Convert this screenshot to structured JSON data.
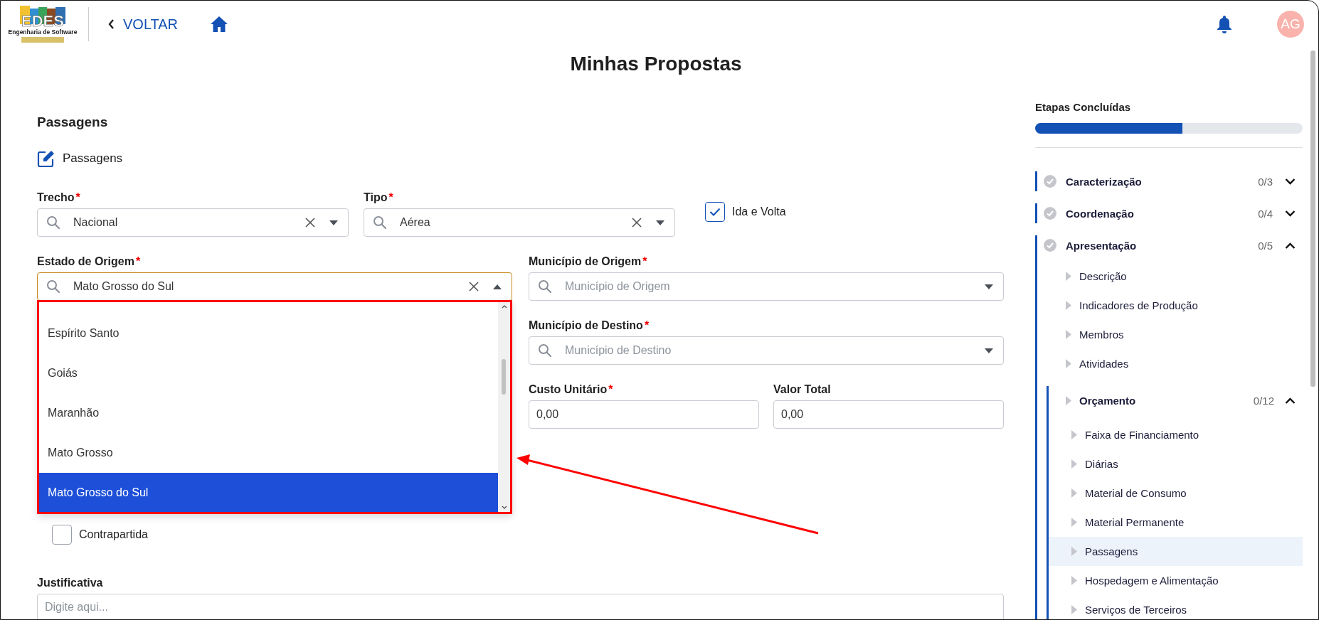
{
  "header": {
    "logo_text": "EDES",
    "logo_subtitle": "Engenharia de Software",
    "back_label": "VOLTAR",
    "avatar_initials": "AG"
  },
  "page_title": "Minhas Propostas",
  "form": {
    "section_title": "Passagens",
    "subtitle": "Passagens",
    "trecho": {
      "label": "Trecho",
      "mark": "*",
      "value": "Nacional",
      "open": false
    },
    "tipo": {
      "label": "Tipo",
      "mark": "*",
      "value": "Aérea",
      "open": false
    },
    "ida_e_volta": {
      "label": "Ida e Volta",
      "checked": true
    },
    "estado_origem": {
      "label": "Estado de Origem",
      "mark": "*",
      "value": "Mato Grosso do Sul",
      "open": true,
      "options": [
        {
          "label": "Espírito Santo",
          "selected": false
        },
        {
          "label": "Goiás",
          "selected": false
        },
        {
          "label": "Maranhão",
          "selected": false
        },
        {
          "label": "Mato Grosso",
          "selected": false
        },
        {
          "label": "Mato Grosso do Sul",
          "selected": true
        }
      ]
    },
    "municipio_origem": {
      "label": "Município de Origem",
      "mark": "*",
      "placeholder": "Município de Origem",
      "open": false
    },
    "municipio_destino": {
      "label": "Município de Destino",
      "mark": "*",
      "placeholder": "Município de Destino",
      "open": false
    },
    "custo_unitario": {
      "label": "Custo Unitário",
      "mark": "*",
      "value": "0,00"
    },
    "valor_total": {
      "label": "Valor Total",
      "value": "0,00"
    },
    "contrapartida": {
      "label": "Contrapartida",
      "checked": false
    },
    "justificativa": {
      "label": "Justificativa",
      "placeholder": "Digite aqui..."
    }
  },
  "progress": {
    "label": "Etapas Concluídas",
    "level": 0.55
  },
  "steps": [
    {
      "label": "Caracterização",
      "count": "0/3",
      "expanded": false
    },
    {
      "label": "Coordenação",
      "count": "0/4",
      "expanded": false
    },
    {
      "label": "Apresentação",
      "count": "0/5",
      "expanded": true,
      "children": [
        {
          "label": "Descrição",
          "selected": false
        },
        {
          "label": "Indicadores de Produção",
          "selected": false
        },
        {
          "label": "Membros",
          "selected": false
        },
        {
          "label": "Atividades",
          "selected": false
        },
        {
          "label": "Orçamento",
          "count": "0/12",
          "expanded": true,
          "selected": false,
          "children": [
            {
              "label": "Faixa de Financiamento",
              "selected": false
            },
            {
              "label": "Diárias",
              "selected": false
            },
            {
              "label": "Material de Consumo",
              "selected": false
            },
            {
              "label": "Material Permanente",
              "selected": false
            },
            {
              "label": "Passagens",
              "selected": true
            },
            {
              "label": "Hospedagem e Alimentação",
              "selected": false
            },
            {
              "label": "Serviços de Terceiros",
              "selected": false
            }
          ]
        }
      ]
    }
  ]
}
